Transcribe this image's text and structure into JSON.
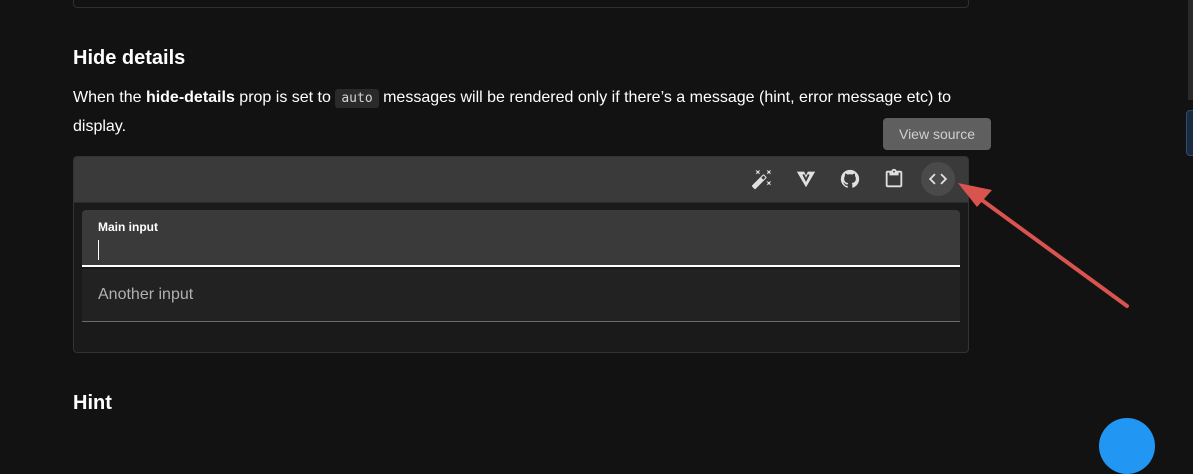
{
  "section": {
    "title": "Hide details",
    "desc_pre": "When the ",
    "desc_prop": "hide-details",
    "desc_mid": " prop is set to ",
    "desc_code": "auto",
    "desc_post": " messages will be rendered only if there’s a message (hint, error message etc) to display."
  },
  "tooltip": {
    "text": "View source"
  },
  "toolbar": {
    "buttons": [
      {
        "icon": "theme-toggle-icon"
      },
      {
        "icon": "vuetify-icon"
      },
      {
        "icon": "github-icon"
      },
      {
        "icon": "clipboard-icon"
      },
      {
        "icon": "code-icon"
      }
    ]
  },
  "example": {
    "main_input": {
      "label": "Main input",
      "value": ""
    },
    "another_input": {
      "placeholder": "Another input"
    }
  },
  "next_section": {
    "title": "Hint"
  },
  "colors": {
    "background": "#121212",
    "toolbar": "#3a3a3a",
    "arrow": "#d9534f",
    "fab": "#2196f3"
  }
}
